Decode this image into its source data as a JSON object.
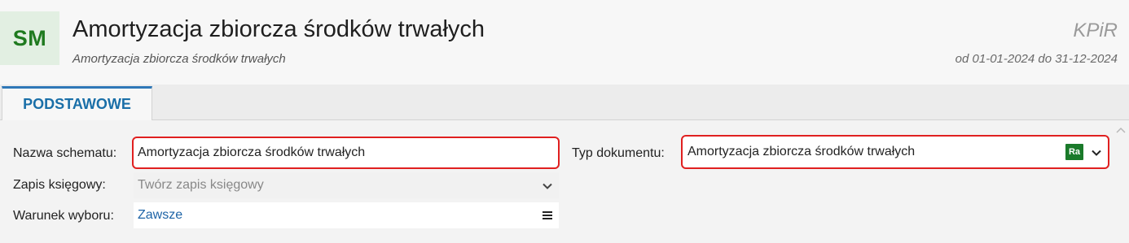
{
  "header": {
    "badge": "SM",
    "title": "Amortyzacja zbiorcza środków trwałych",
    "subtitle": "Amortyzacja zbiorcza środków trwałych",
    "right_title": "KPiR",
    "period": "od 01-01-2024 do 31-12-2024"
  },
  "tabs": [
    {
      "label": "PODSTAWOWE",
      "active": true
    }
  ],
  "form": {
    "schema_name_label": "Nazwa schematu:",
    "schema_name_value": "Amortyzacja zbiorcza środków trwałych",
    "entry_label": "Zapis księgowy:",
    "entry_value": "Twórz zapis księgowy",
    "condition_label": "Warunek wyboru:",
    "condition_value": "Zawsze",
    "doc_type_label": "Typ dokumentu:",
    "doc_type_value": "Amortyzacja zbiorcza środków trwałych",
    "doc_type_badge": "Ra"
  },
  "icons": {
    "dropdown": "chevron-down-icon",
    "menu": "menu-icon",
    "scroll": "chevron-up-icon"
  },
  "colors": {
    "badge_bg": "#e2efe2",
    "badge_text": "#1f7a1f",
    "tab_accent": "#2f78b7",
    "highlight": "#e02020",
    "ra_badge": "#1a7a2a",
    "link": "#1d63a6"
  }
}
